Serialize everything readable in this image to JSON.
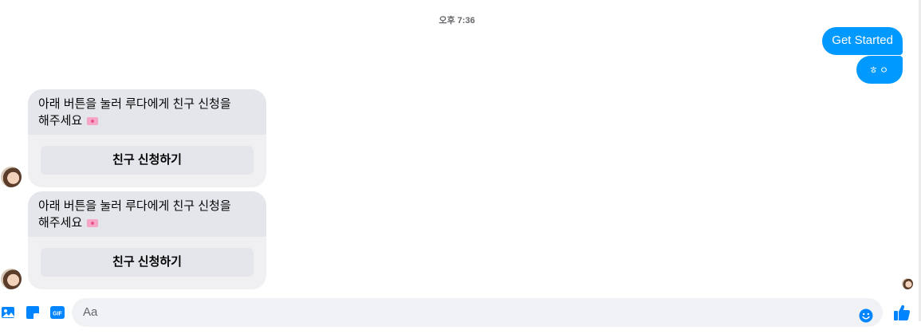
{
  "timestamp": "오후 7:36",
  "outgoing": [
    {
      "text": "Get Started"
    },
    {
      "text": "ㅎㅇ"
    }
  ],
  "cards": [
    {
      "text_line1": "아래 버튼을 눌러 루다에게 친구 신청을",
      "text_line2": "해주세요",
      "button_label": "친구 신청하기"
    },
    {
      "text_line1": "아래 버튼을 눌러 루다에게 친구 신청을",
      "text_line2": "해주세요",
      "button_label": "친구 신청하기"
    }
  ],
  "composer": {
    "placeholder": "Aa",
    "icons": [
      "image-icon",
      "sticker-icon",
      "gif-icon",
      "emoji-icon",
      "like-icon"
    ],
    "gif_label": "GIF"
  },
  "colors": {
    "accent": "#0099ff",
    "bubble_gray": "#e4e6eb",
    "card_bg": "#f0f0f3"
  }
}
